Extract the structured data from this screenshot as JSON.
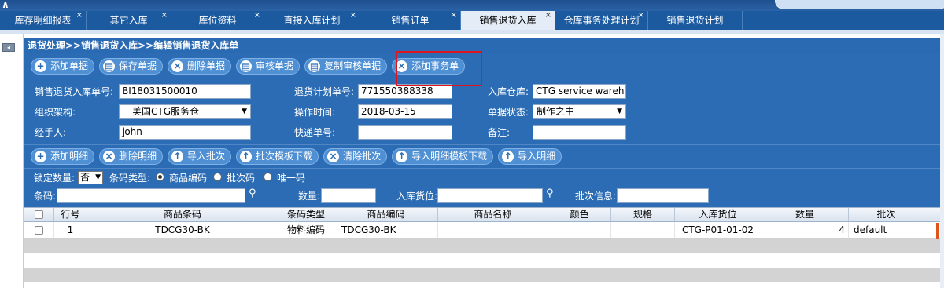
{
  "top": {
    "logo_mark": "∧"
  },
  "tabs": [
    {
      "label": "库存明细报表",
      "active": false
    },
    {
      "label": "其它入库",
      "active": false
    },
    {
      "label": "库位资料",
      "active": false
    },
    {
      "label": "直接入库计划",
      "active": false
    },
    {
      "label": "销售订单",
      "active": false
    },
    {
      "label": "销售退货入库",
      "active": true
    },
    {
      "label": "仓库事务处理计划",
      "active": false
    },
    {
      "label": "销售退货计划",
      "active": false
    }
  ],
  "tab_close": "×",
  "breadcrumb": "退货处理>>销售退货入库>>编辑销售退货入库单",
  "toolbar": {
    "add": "添加单据",
    "save": "保存单据",
    "delete": "删除单据",
    "audit": "审核单据",
    "copy_audit": "复制审核单据",
    "add_affair": "添加事务单"
  },
  "form": {
    "order_no_label": "销售退货入库单号:",
    "order_no_value": "BI18031500010",
    "plan_no_label": "退货计划单号:",
    "plan_no_value": "771550388338",
    "warehouse_label": "入库仓库:",
    "warehouse_value": "CTG service warehou",
    "org_label": "组织架构:",
    "org_value": "美国CTG服务仓",
    "op_time_label": "操作时间:",
    "op_time_value": "2018-03-15",
    "status_label": "单据状态:",
    "status_value": "制作之中",
    "handler_label": "经手人:",
    "handler_value": "john",
    "express_label": "快递单号:",
    "express_value": "",
    "remark_label": "备注:",
    "remark_value": ""
  },
  "toolbar2": {
    "add_detail": "添加明细",
    "delete_detail": "删除明细",
    "import_batch": "导入批次",
    "batch_template": "批次模板下载",
    "clear_batch": "清除批次",
    "import_detail_template": "导入明细模板下载",
    "import_detail": "导入明细"
  },
  "filters": {
    "lock_qty_label": "锁定数量:",
    "lock_qty_value": "否",
    "barcode_type_label": "条码类型:",
    "radio_product_code": "商品编码",
    "radio_batch_code": "批次码",
    "radio_unique_code": "唯一码",
    "barcode_label": "条码:",
    "qty_label": "数量:",
    "location_label": "入库货位:",
    "batch_info_label": "批次信息:"
  },
  "grid": {
    "columns": [
      "",
      "行号",
      "商品条码",
      "条码类型",
      "商品编码",
      "商品名称",
      "颜色",
      "规格",
      "入库货位",
      "数量",
      "批次"
    ],
    "rows": [
      [
        "",
        "1",
        "TDCG30-BK",
        "物料编码",
        "TDCG30-BK",
        "",
        "",
        "",
        "CTG-P01-01-02",
        "4",
        "default"
      ]
    ]
  }
}
